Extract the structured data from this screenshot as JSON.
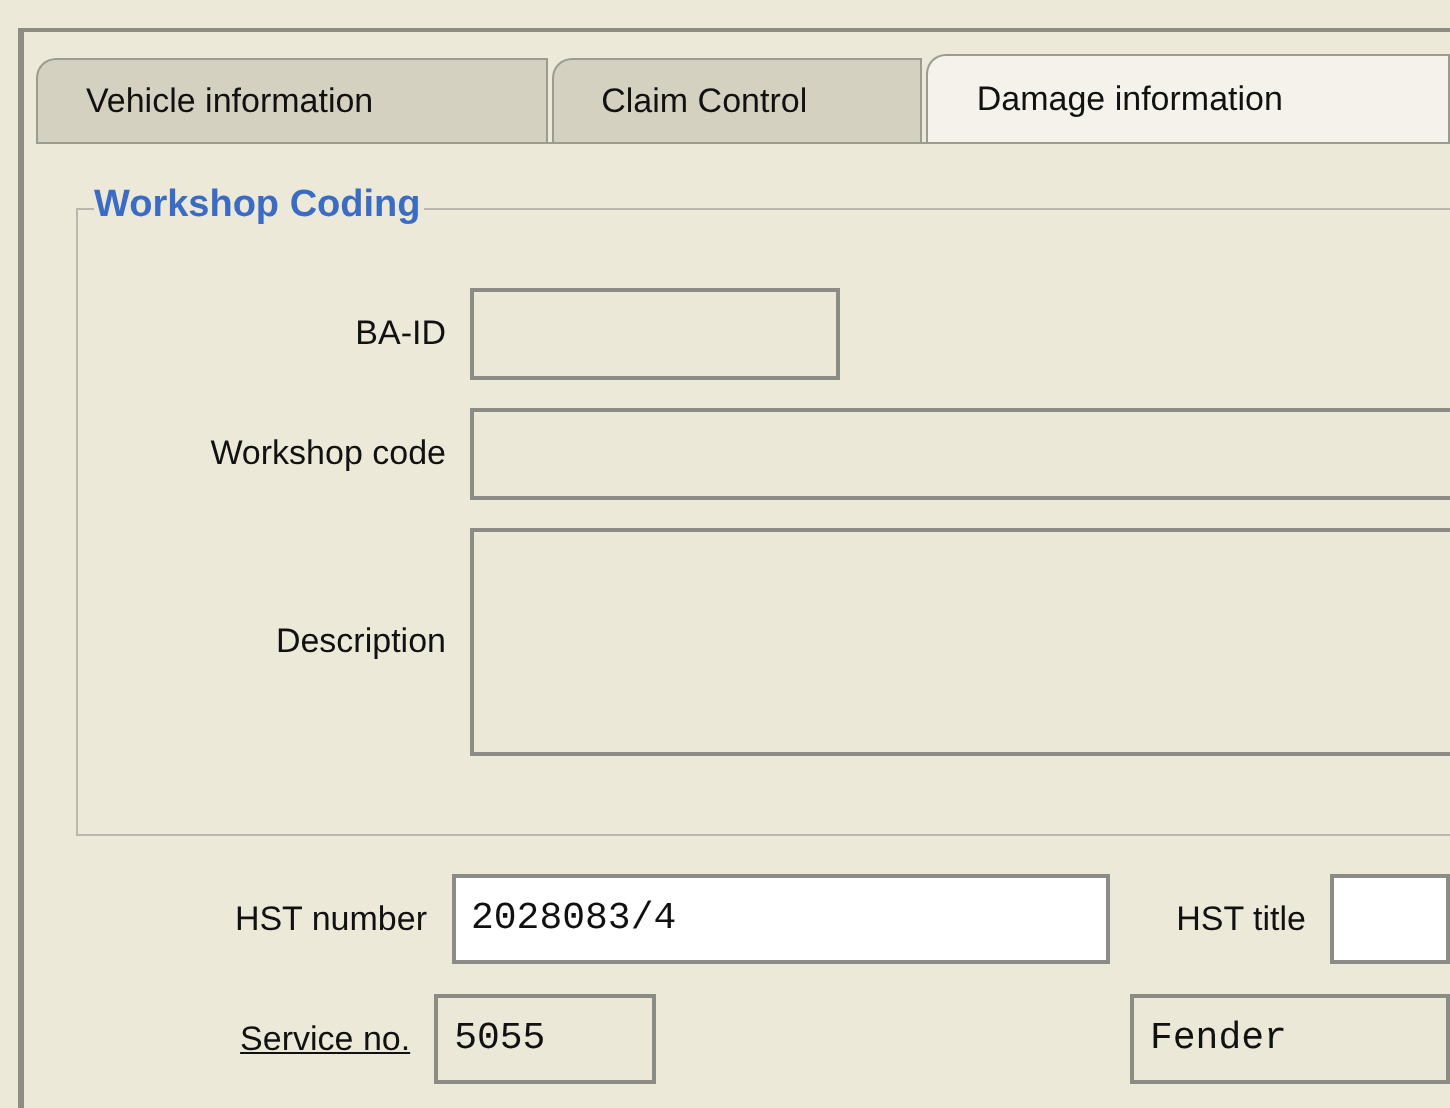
{
  "tabs": [
    {
      "label": "Vehicle information",
      "selected": false
    },
    {
      "label": "Claim Control",
      "selected": false
    },
    {
      "label": "Damage information",
      "selected": true
    }
  ],
  "group": {
    "title": "Workshop Coding",
    "fields": [
      {
        "label": "BA-ID",
        "kind": "short"
      },
      {
        "label": "Workshop code",
        "kind": "wide"
      },
      {
        "label": "Description",
        "kind": "multiline"
      }
    ]
  },
  "rows": [
    [
      {
        "label": "HST number",
        "underlined": false,
        "value": "2028083/4",
        "editable": true
      },
      {
        "label": "HST title",
        "underlined": false,
        "editable": true
      }
    ],
    [
      {
        "label": "Service no.",
        "underlined": true,
        "value": "5055",
        "editable": false
      },
      {
        "value": "Fender",
        "editable": false
      }
    ]
  ]
}
